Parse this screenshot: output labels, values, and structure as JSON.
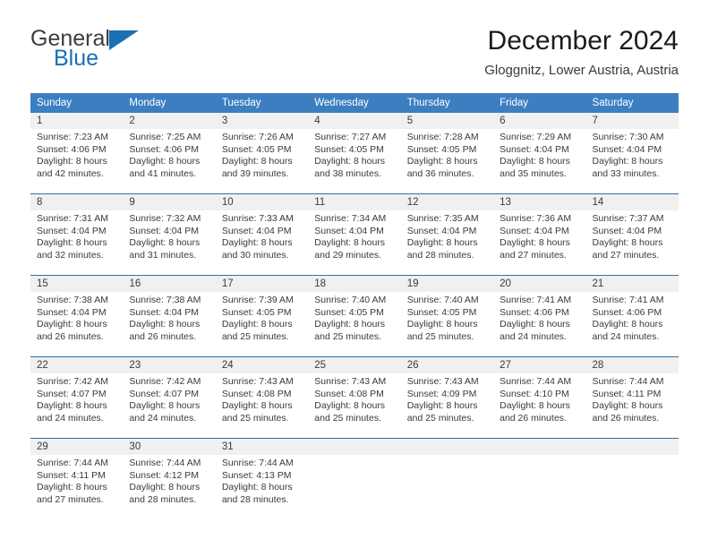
{
  "brand": {
    "word1": "General",
    "word2": "Blue",
    "accent_color": "#1b6fb3"
  },
  "header": {
    "title": "December 2024",
    "subtitle": "Gloggnitz, Lower Austria, Austria"
  },
  "calendar": {
    "header_bg": "#3c7fc1",
    "daynum_bg": "#f0f0f0",
    "weekday_headers": [
      "Sunday",
      "Monday",
      "Tuesday",
      "Wednesday",
      "Thursday",
      "Friday",
      "Saturday"
    ],
    "weeks": [
      [
        {
          "day": "1",
          "lines": [
            "Sunrise: 7:23 AM",
            "Sunset: 4:06 PM",
            "Daylight: 8 hours",
            "and 42 minutes."
          ]
        },
        {
          "day": "2",
          "lines": [
            "Sunrise: 7:25 AM",
            "Sunset: 4:06 PM",
            "Daylight: 8 hours",
            "and 41 minutes."
          ]
        },
        {
          "day": "3",
          "lines": [
            "Sunrise: 7:26 AM",
            "Sunset: 4:05 PM",
            "Daylight: 8 hours",
            "and 39 minutes."
          ]
        },
        {
          "day": "4",
          "lines": [
            "Sunrise: 7:27 AM",
            "Sunset: 4:05 PM",
            "Daylight: 8 hours",
            "and 38 minutes."
          ]
        },
        {
          "day": "5",
          "lines": [
            "Sunrise: 7:28 AM",
            "Sunset: 4:05 PM",
            "Daylight: 8 hours",
            "and 36 minutes."
          ]
        },
        {
          "day": "6",
          "lines": [
            "Sunrise: 7:29 AM",
            "Sunset: 4:04 PM",
            "Daylight: 8 hours",
            "and 35 minutes."
          ]
        },
        {
          "day": "7",
          "lines": [
            "Sunrise: 7:30 AM",
            "Sunset: 4:04 PM",
            "Daylight: 8 hours",
            "and 33 minutes."
          ]
        }
      ],
      [
        {
          "day": "8",
          "lines": [
            "Sunrise: 7:31 AM",
            "Sunset: 4:04 PM",
            "Daylight: 8 hours",
            "and 32 minutes."
          ]
        },
        {
          "day": "9",
          "lines": [
            "Sunrise: 7:32 AM",
            "Sunset: 4:04 PM",
            "Daylight: 8 hours",
            "and 31 minutes."
          ]
        },
        {
          "day": "10",
          "lines": [
            "Sunrise: 7:33 AM",
            "Sunset: 4:04 PM",
            "Daylight: 8 hours",
            "and 30 minutes."
          ]
        },
        {
          "day": "11",
          "lines": [
            "Sunrise: 7:34 AM",
            "Sunset: 4:04 PM",
            "Daylight: 8 hours",
            "and 29 minutes."
          ]
        },
        {
          "day": "12",
          "lines": [
            "Sunrise: 7:35 AM",
            "Sunset: 4:04 PM",
            "Daylight: 8 hours",
            "and 28 minutes."
          ]
        },
        {
          "day": "13",
          "lines": [
            "Sunrise: 7:36 AM",
            "Sunset: 4:04 PM",
            "Daylight: 8 hours",
            "and 27 minutes."
          ]
        },
        {
          "day": "14",
          "lines": [
            "Sunrise: 7:37 AM",
            "Sunset: 4:04 PM",
            "Daylight: 8 hours",
            "and 27 minutes."
          ]
        }
      ],
      [
        {
          "day": "15",
          "lines": [
            "Sunrise: 7:38 AM",
            "Sunset: 4:04 PM",
            "Daylight: 8 hours",
            "and 26 minutes."
          ]
        },
        {
          "day": "16",
          "lines": [
            "Sunrise: 7:38 AM",
            "Sunset: 4:04 PM",
            "Daylight: 8 hours",
            "and 26 minutes."
          ]
        },
        {
          "day": "17",
          "lines": [
            "Sunrise: 7:39 AM",
            "Sunset: 4:05 PM",
            "Daylight: 8 hours",
            "and 25 minutes."
          ]
        },
        {
          "day": "18",
          "lines": [
            "Sunrise: 7:40 AM",
            "Sunset: 4:05 PM",
            "Daylight: 8 hours",
            "and 25 minutes."
          ]
        },
        {
          "day": "19",
          "lines": [
            "Sunrise: 7:40 AM",
            "Sunset: 4:05 PM",
            "Daylight: 8 hours",
            "and 25 minutes."
          ]
        },
        {
          "day": "20",
          "lines": [
            "Sunrise: 7:41 AM",
            "Sunset: 4:06 PM",
            "Daylight: 8 hours",
            "and 24 minutes."
          ]
        },
        {
          "day": "21",
          "lines": [
            "Sunrise: 7:41 AM",
            "Sunset: 4:06 PM",
            "Daylight: 8 hours",
            "and 24 minutes."
          ]
        }
      ],
      [
        {
          "day": "22",
          "lines": [
            "Sunrise: 7:42 AM",
            "Sunset: 4:07 PM",
            "Daylight: 8 hours",
            "and 24 minutes."
          ]
        },
        {
          "day": "23",
          "lines": [
            "Sunrise: 7:42 AM",
            "Sunset: 4:07 PM",
            "Daylight: 8 hours",
            "and 24 minutes."
          ]
        },
        {
          "day": "24",
          "lines": [
            "Sunrise: 7:43 AM",
            "Sunset: 4:08 PM",
            "Daylight: 8 hours",
            "and 25 minutes."
          ]
        },
        {
          "day": "25",
          "lines": [
            "Sunrise: 7:43 AM",
            "Sunset: 4:08 PM",
            "Daylight: 8 hours",
            "and 25 minutes."
          ]
        },
        {
          "day": "26",
          "lines": [
            "Sunrise: 7:43 AM",
            "Sunset: 4:09 PM",
            "Daylight: 8 hours",
            "and 25 minutes."
          ]
        },
        {
          "day": "27",
          "lines": [
            "Sunrise: 7:44 AM",
            "Sunset: 4:10 PM",
            "Daylight: 8 hours",
            "and 26 minutes."
          ]
        },
        {
          "day": "28",
          "lines": [
            "Sunrise: 7:44 AM",
            "Sunset: 4:11 PM",
            "Daylight: 8 hours",
            "and 26 minutes."
          ]
        }
      ],
      [
        {
          "day": "29",
          "lines": [
            "Sunrise: 7:44 AM",
            "Sunset: 4:11 PM",
            "Daylight: 8 hours",
            "and 27 minutes."
          ]
        },
        {
          "day": "30",
          "lines": [
            "Sunrise: 7:44 AM",
            "Sunset: 4:12 PM",
            "Daylight: 8 hours",
            "and 28 minutes."
          ]
        },
        {
          "day": "31",
          "lines": [
            "Sunrise: 7:44 AM",
            "Sunset: 4:13 PM",
            "Daylight: 8 hours",
            "and 28 minutes."
          ]
        },
        {
          "day": "",
          "lines": []
        },
        {
          "day": "",
          "lines": []
        },
        {
          "day": "",
          "lines": []
        },
        {
          "day": "",
          "lines": []
        }
      ]
    ]
  }
}
